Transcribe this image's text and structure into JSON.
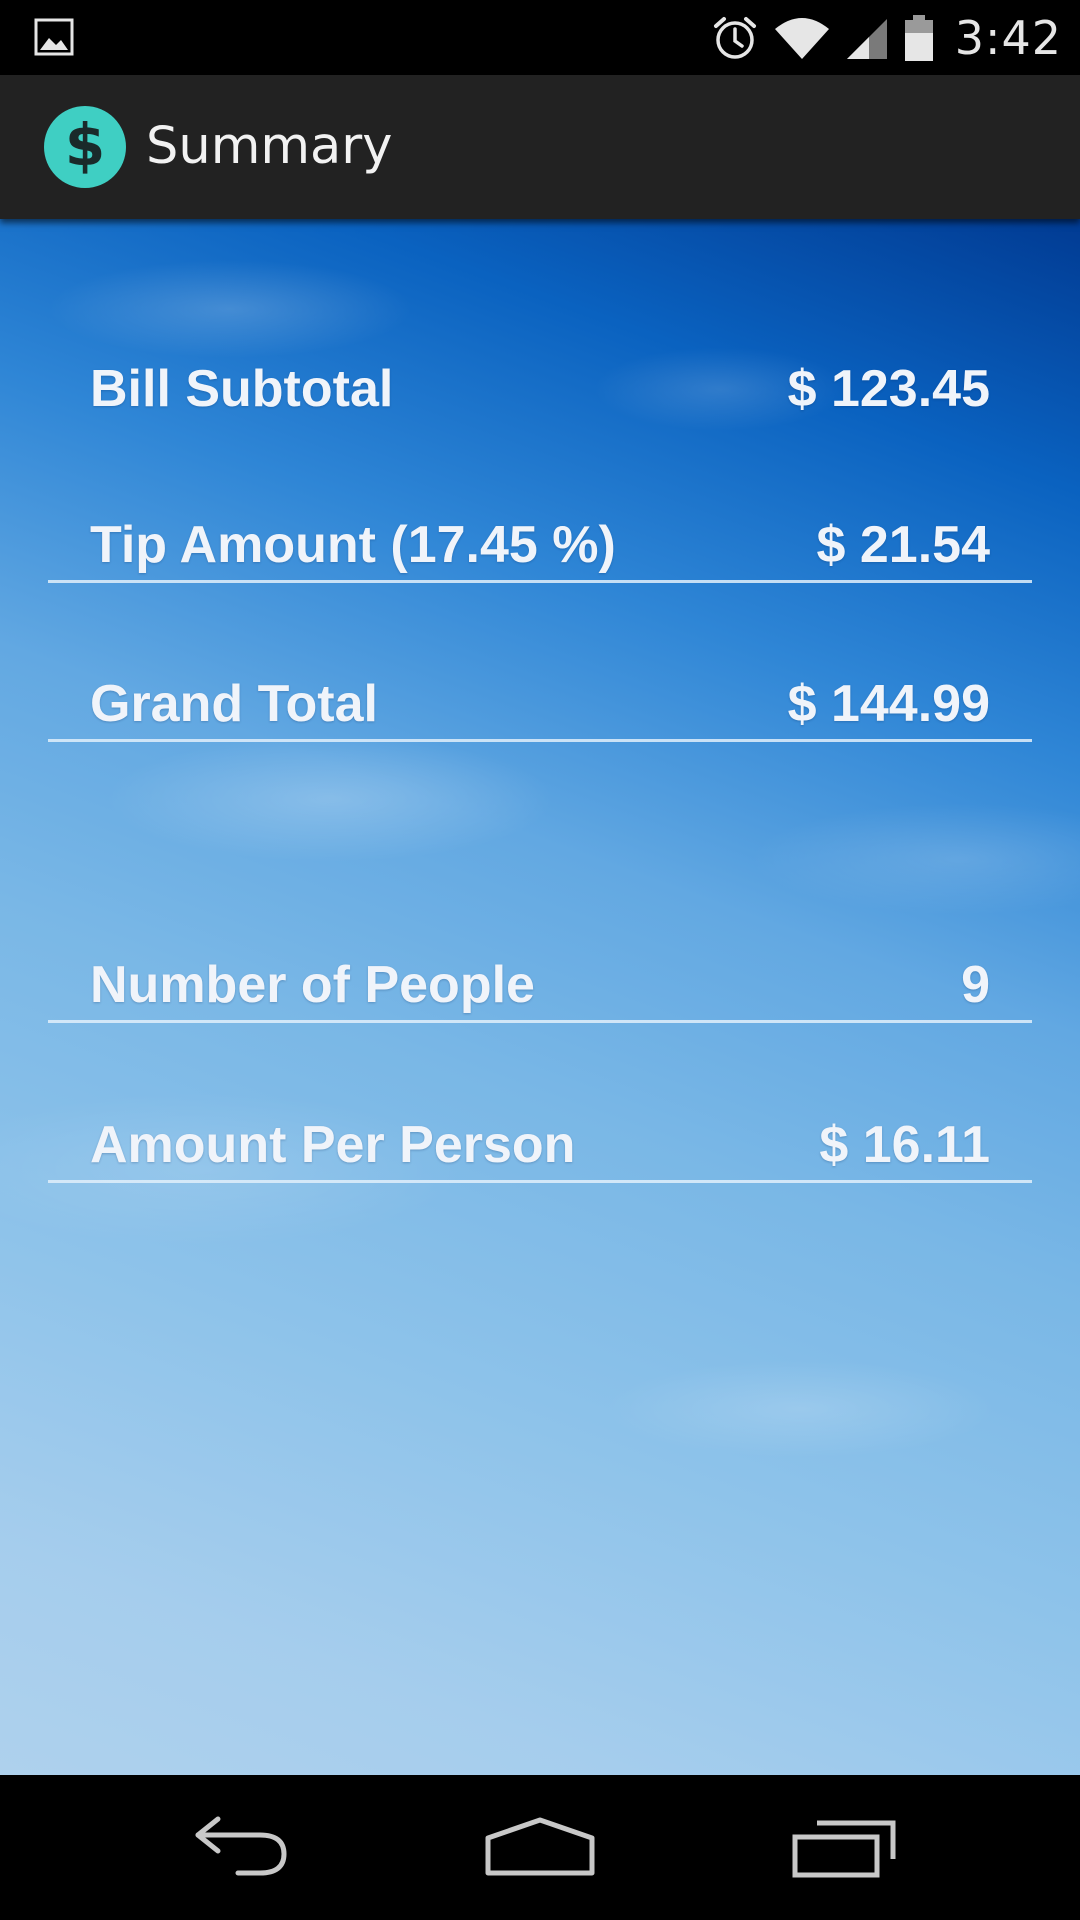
{
  "status_bar": {
    "time": "3:42",
    "icons": [
      "gallery-icon",
      "alarm-icon",
      "wifi-icon",
      "cell-signal-icon",
      "battery-icon"
    ]
  },
  "action_bar": {
    "title": "Summary",
    "app_icon_glyph": "$",
    "app_icon_color": "#3fcfc3"
  },
  "summary": {
    "bill_subtotal": {
      "label": "Bill Subtotal",
      "value": "$ 123.45"
    },
    "tip_amount": {
      "label": "Tip Amount (17.45 %)",
      "value": "$ 21.54"
    },
    "grand_total": {
      "label": "Grand Total",
      "value": "$ 144.99"
    },
    "number_of_people": {
      "label": "Number of People",
      "value": "9"
    },
    "amount_per_person": {
      "label": "Amount Per Person",
      "value": "$ 16.11"
    }
  },
  "nav_bar": {
    "buttons": [
      "back-icon",
      "home-icon",
      "recent-apps-icon"
    ]
  },
  "colors": {
    "background_top": "#013b93",
    "background_bottom": "#aed1ed",
    "text": "#f0f4fa",
    "action_bar": "#222222"
  }
}
